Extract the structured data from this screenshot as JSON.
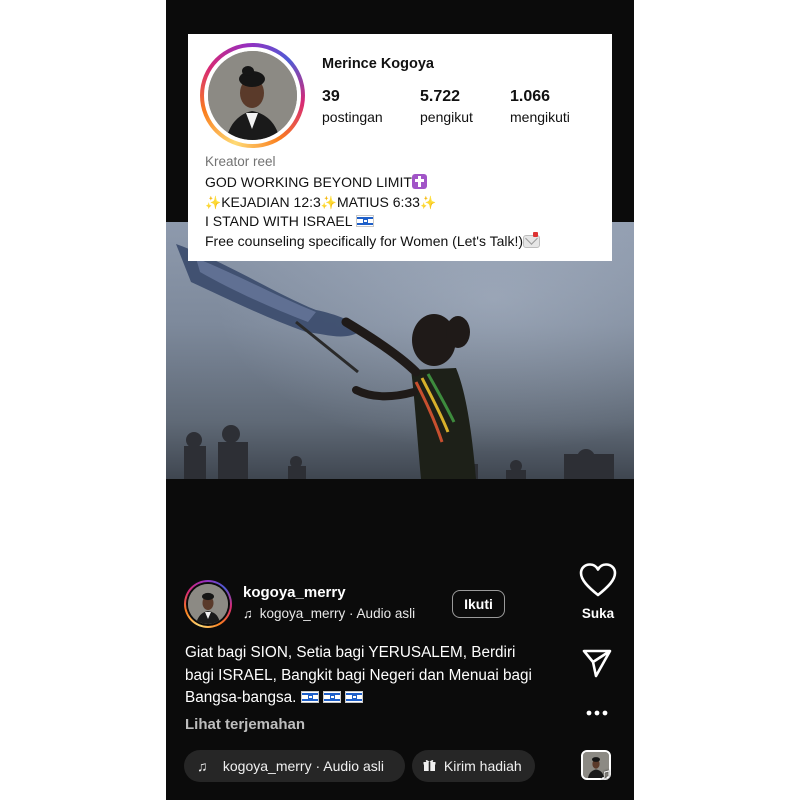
{
  "profile": {
    "name": "Merince Kogoya",
    "stats": [
      {
        "value": "39",
        "label": "postingan"
      },
      {
        "value": "5.722",
        "label": "pengikut"
      },
      {
        "value": "1.066",
        "label": "mengikuti"
      }
    ],
    "category": "Kreator reel",
    "bio": {
      "line1": "GOD WORKING BEYOND LIMIT",
      "line2_a": "KEJADIAN 12:3",
      "line2_b": "MATIUS 6:33",
      "line3": "I STAND WITH ISRAEL",
      "line4": "Free counseling specifically for Women (Let's Talk!)"
    }
  },
  "reel": {
    "username": "kogoya_merry",
    "audio_line": "kogoya_merry · Audio asli",
    "follow_label": "Ikuti",
    "caption": "Giat bagi SION, Setia bagi YERUSALEM, Berdiri bagi ISRAEL, Bangkit bagi Negeri dan Menuai bagi Bangsa-bangsa.",
    "translate_label": "Lihat terjemahan",
    "audio_chip": "kogoya_merry · Audio asli",
    "gift_chip": "Kirim hadiah",
    "like_label": "Suka"
  },
  "icons": {
    "like": "heart-icon",
    "share": "send-icon",
    "more": "more-dots-icon",
    "audio": "music-note-icon",
    "gift": "gift-icon"
  },
  "colors": {
    "background": "#0b0b0b",
    "card": "#ffffff",
    "chip": "#262626",
    "story_ring": [
      "#feda75",
      "#fa7e1e",
      "#d62976",
      "#962fbf",
      "#4f5bd5"
    ]
  }
}
